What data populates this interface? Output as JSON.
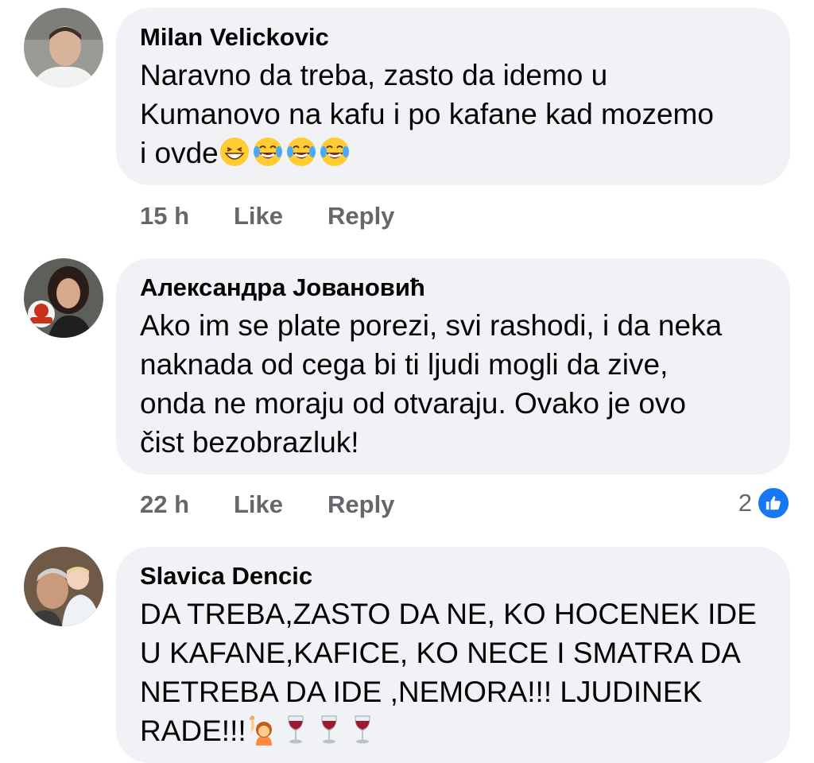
{
  "colors": {
    "bubble_bg": "#f0f2f5",
    "meta_text": "#65676b",
    "like_blue": "#1877f2"
  },
  "comments": [
    {
      "author": "Milan Velickovic",
      "lines": [
        "Naravno da treba, zasto da idemo u",
        "Kumanovo na kafu i po kafane kad mozemo",
        "i ovde"
      ],
      "emojis": [
        "grinning-squint-emoji",
        "tears-of-joy-emoji",
        "tears-of-joy-emoji",
        "tears-of-joy-emoji"
      ],
      "time": "15 h",
      "like_label": "Like",
      "reply_label": "Reply"
    },
    {
      "author": "Александра Јовановић",
      "lines": [
        "Ako im se plate porezi, svi rashodi, i da neka",
        "naknada od cega bi ti ljudi mogli da zive,",
        "onda ne moraju od otvaraju. Ovako je ovo",
        "čist bezobrazluk!"
      ],
      "time": "22 h",
      "like_label": "Like",
      "reply_label": "Reply",
      "reaction_count": "2",
      "reaction_icon": "thumbs-up-icon"
    },
    {
      "author": "Slavica Dencic",
      "lines": [
        "DA TREBA,ZASTO DA NE, KO HOCENEK IDE",
        "U KAFANE,KAFICE, KO NECE I SMATRA DA",
        "NETREBA DA IDE ,NEMORA!!! LJUDINEK",
        "RADE!!!"
      ],
      "emojis": [
        "person-raising-hand-emoji",
        "wine-glass-emoji",
        "wine-glass-emoji",
        "wine-glass-emoji"
      ]
    }
  ]
}
